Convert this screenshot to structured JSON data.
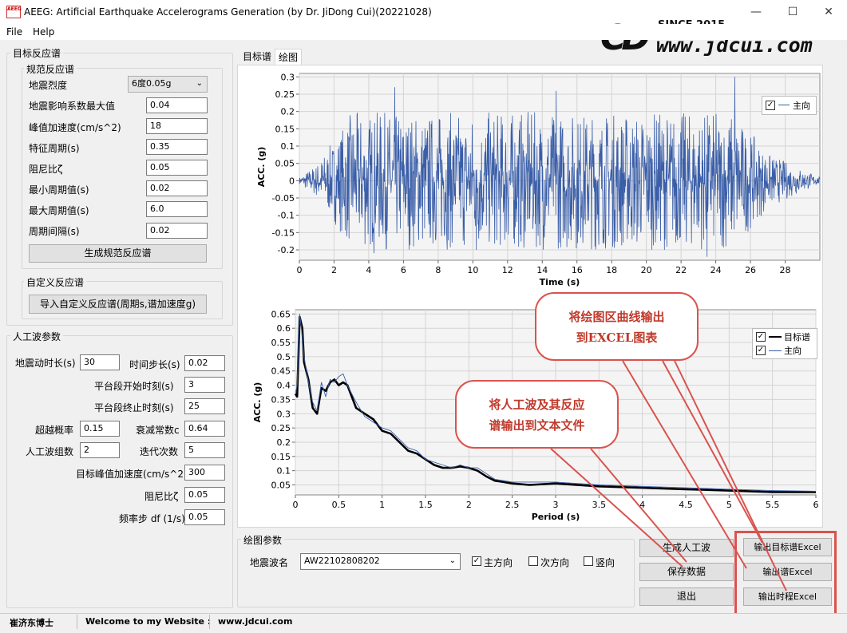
{
  "window": {
    "title": "AEEG: Artificial Earthquake Accelerograms Generation (by Dr. JiDong Cui)(20221028)",
    "icon_text": "AEEG",
    "minimize": "—",
    "maximize": "☐",
    "close": "✕"
  },
  "menu": {
    "file": "File",
    "help": "Help"
  },
  "watermark": {
    "logo": "CD",
    "since": "SINCE 2015",
    "url": "www.jdcui.com"
  },
  "target_spectrum": {
    "title": "目标反应谱",
    "code_group": {
      "title": "规范反应谱",
      "intensity": {
        "label": "地震烈度",
        "value": "6度0.05g"
      },
      "alpha_max": {
        "label": "地震影响系数最大值",
        "value": "0.04"
      },
      "pga": {
        "label": "峰值加速度(cm/s^2)",
        "value": "18"
      },
      "tg": {
        "label": "特征周期(s)",
        "value": "0.35"
      },
      "damping": {
        "label": "阻尼比ζ",
        "value": "0.05"
      },
      "tmin": {
        "label": "最小周期值(s)",
        "value": "0.02"
      },
      "tmax": {
        "label": "最大周期值(s)",
        "value": "6.0"
      },
      "tstep": {
        "label": "周期间隔(s)",
        "value": "0.02"
      },
      "generate_btn": "生成规范反应谱"
    },
    "custom_group": {
      "title": "自定义反应谱",
      "import_btn": "导入自定义反应谱(周期s,谱加速度g)"
    }
  },
  "artificial_wave": {
    "title": "人工波参数",
    "duration": {
      "label": "地震动时长(s)",
      "value": "30"
    },
    "dt": {
      "label": "时间步长(s)",
      "value": "0.02"
    },
    "plateau_start": {
      "label": "平台段开始时刻(s)",
      "value": "3"
    },
    "plateau_end": {
      "label": "平台段终止时刻(s)",
      "value": "25"
    },
    "exceed_prob": {
      "label": "超越概率",
      "value": "0.15"
    },
    "decay": {
      "label": "衰减常数c",
      "value": "0.64"
    },
    "groups": {
      "label": "人工波组数",
      "value": "2"
    },
    "iterations": {
      "label": "迭代次数",
      "value": "5"
    },
    "target_pga": {
      "label": "目标峰值加速度(cm/s^2)",
      "value": "300"
    },
    "damping": {
      "label": "阻尼比ζ",
      "value": "0.05"
    },
    "df": {
      "label": "频率步 df (1/s)",
      "value": "0.05"
    }
  },
  "tabs": [
    {
      "label": "目标谱"
    },
    {
      "label": "绘图"
    }
  ],
  "chart_top": {
    "ylabel": "ACC. (g)",
    "xlabel": "Time (s)",
    "legend_label": "主向",
    "legend_check": "✓"
  },
  "chart_bottom": {
    "ylabel": "ACC. (g)",
    "xlabel": "Period (s)",
    "legend_target": "目标谱",
    "legend_main": "主向",
    "legend_check": "✓"
  },
  "chart_data": [
    {
      "type": "line",
      "xlabel": "Time (s)",
      "ylabel": "ACC. (g)",
      "xlim": [
        0,
        30
      ],
      "ylim": [
        -0.23,
        0.31
      ],
      "x_ticks": [
        0,
        2,
        4,
        6,
        8,
        10,
        12,
        14,
        16,
        18,
        20,
        22,
        24,
        26,
        28
      ],
      "x_tick_labels": [
        "0",
        "2",
        "4",
        "6",
        "8",
        "10",
        "12",
        "14",
        "16",
        "18",
        "20",
        "22",
        "24",
        "26",
        "28"
      ],
      "y_ticks": [
        -0.2,
        -0.15,
        -0.1,
        -0.05,
        0,
        0.05,
        0.1,
        0.15,
        0.2,
        0.25,
        0.3
      ],
      "y_tick_labels": [
        "-0.2",
        "-0.15",
        "-0.1",
        "-0.05",
        "0",
        "0.05",
        "0.1",
        "0.15",
        "0.2",
        "0.25",
        "0.3"
      ],
      "grid": true,
      "legend": "top-right",
      "series": [
        {
          "name": "主向",
          "color": "#3a5ea8",
          "envelope_t": [
            0,
            1,
            2,
            3,
            25,
            27,
            30
          ],
          "envelope_a": [
            0.01,
            0.05,
            0.12,
            0.2,
            0.2,
            0.08,
            0.01
          ],
          "peaks": [
            [
              25.1,
              0.3
            ],
            [
              23.5,
              -0.22
            ],
            [
              5.5,
              0.27
            ],
            [
              4.3,
              -0.21
            ],
            [
              14.8,
              0.26
            ],
            [
              10.2,
              -0.2
            ]
          ]
        }
      ]
    },
    {
      "type": "line",
      "xlabel": "Period (s)",
      "ylabel": "ACC. (g)",
      "xlim": [
        0,
        6
      ],
      "ylim": [
        0.015,
        0.665
      ],
      "x_ticks": [
        0,
        0.5,
        1,
        1.5,
        2,
        2.5,
        3,
        3.5,
        4,
        4.5,
        5,
        5.5,
        6
      ],
      "x_tick_labels": [
        "0",
        "0.5",
        "1",
        "1.5",
        "2",
        "2.5",
        "3",
        "3.5",
        "4",
        "4.5",
        "5",
        "5.5",
        "6"
      ],
      "y_ticks": [
        0.05,
        0.1,
        0.15,
        0.2,
        0.25,
        0.3,
        0.35,
        0.4,
        0.45,
        0.5,
        0.55,
        0.6,
        0.65
      ],
      "y_tick_labels": [
        "0.05",
        "0.1",
        "0.15",
        "0.2",
        "0.25",
        "0.3",
        "0.35",
        "0.4",
        "0.45",
        "0.5",
        "0.55",
        "0.6",
        "0.65"
      ],
      "grid": true,
      "legend": "top-right",
      "series": [
        {
          "name": "目标谱",
          "color": "#000000",
          "x": [
            0,
            0.02,
            0.05,
            0.08,
            0.1,
            0.15,
            0.2,
            0.25,
            0.3,
            0.35,
            0.4,
            0.45,
            0.5,
            0.55,
            0.6,
            0.7,
            0.8,
            0.9,
            1.0,
            1.1,
            1.2,
            1.3,
            1.4,
            1.5,
            1.6,
            1.7,
            1.8,
            1.9,
            2.0,
            2.1,
            2.2,
            2.3,
            2.4,
            2.5,
            2.7,
            3.0,
            3.5,
            4.0,
            4.5,
            5.0,
            5.5,
            6.0
          ],
          "y": [
            0.37,
            0.36,
            0.64,
            0.6,
            0.48,
            0.42,
            0.32,
            0.3,
            0.39,
            0.38,
            0.41,
            0.42,
            0.4,
            0.41,
            0.4,
            0.32,
            0.3,
            0.28,
            0.24,
            0.23,
            0.2,
            0.17,
            0.16,
            0.14,
            0.12,
            0.11,
            0.11,
            0.115,
            0.11,
            0.1,
            0.08,
            0.065,
            0.06,
            0.055,
            0.05,
            0.055,
            0.045,
            0.04,
            0.035,
            0.03,
            0.025,
            0.025
          ]
        },
        {
          "name": "主向",
          "color": "#3a5ea8",
          "x": [
            0,
            0.02,
            0.05,
            0.08,
            0.1,
            0.15,
            0.2,
            0.25,
            0.3,
            0.35,
            0.4,
            0.45,
            0.5,
            0.55,
            0.6,
            0.7,
            0.8,
            0.9,
            1.0,
            1.1,
            1.2,
            1.3,
            1.4,
            1.5,
            1.6,
            1.7,
            1.8,
            1.9,
            2.0,
            2.1,
            2.2,
            2.3,
            2.4,
            2.5,
            2.7,
            3.0,
            3.5,
            4.0,
            4.5,
            5.0,
            5.5,
            6.0
          ],
          "y": [
            0.37,
            0.4,
            0.65,
            0.57,
            0.5,
            0.41,
            0.34,
            0.31,
            0.41,
            0.36,
            0.42,
            0.41,
            0.43,
            0.44,
            0.4,
            0.34,
            0.29,
            0.27,
            0.25,
            0.24,
            0.21,
            0.18,
            0.17,
            0.14,
            0.13,
            0.12,
            0.11,
            0.12,
            0.11,
            0.11,
            0.09,
            0.07,
            0.065,
            0.06,
            0.06,
            0.06,
            0.05,
            0.045,
            0.04,
            0.035,
            0.03,
            0.028
          ]
        }
      ]
    }
  ],
  "plot_params": {
    "title": "绘图参数",
    "wave_label": "地震波名",
    "wave_value": "AW22102808202",
    "main_dir": "主方向",
    "second_dir": "次方向",
    "vertical": "竖向",
    "main_checked": "✓"
  },
  "buttons": {
    "generate": "生成人工波",
    "save": "保存数据",
    "exit": "退出",
    "export_target": "输出目标谱Excel",
    "export_spectrum": "输出谱Excel",
    "export_history": "输出时程Excel"
  },
  "callouts": {
    "excel_chart": [
      "将绘图区曲线输出",
      "到EXCEL图表"
    ],
    "text_file": [
      "将人工波及其反应",
      "谱输出到文本文件"
    ]
  },
  "status": {
    "author": "崔济东博士",
    "welcome": "Welcome to my Website :",
    "site": "www.jdcui.com"
  },
  "colors": {
    "accent_red": "#d9534f",
    "series_blue": "#3a5ea8"
  }
}
